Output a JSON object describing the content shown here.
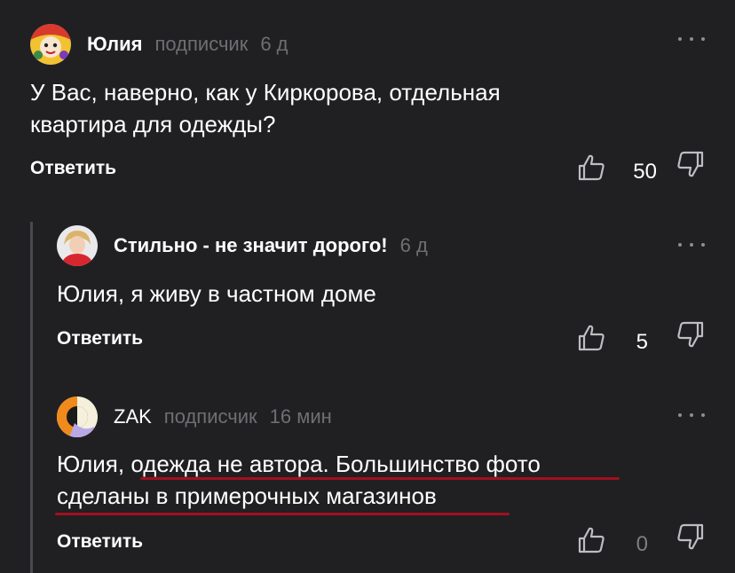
{
  "comments": [
    {
      "author": "Юлия",
      "role": "подписчик",
      "time": "6 д",
      "text_lines": [
        "У Вас, наверно, как у Киркорова, отдельная",
        "квартира для одежды?"
      ],
      "reply_label": "Ответить",
      "likes": "50",
      "avatar": "colorful-cartoon-avatar"
    },
    {
      "author": "Стильно - не значит дорого!",
      "role": "",
      "time": "6 д",
      "text_lines": [
        "Юлия, я живу в частном доме"
      ],
      "reply_label": "Ответить",
      "likes": "5",
      "avatar": "woman-photo-avatar"
    },
    {
      "author": "ZAK",
      "role": "подписчик",
      "time": "16 мин",
      "text_lines": [
        "Юлия, одежда не автора. Большинство фото",
        "сделаны в примерочных магазинов"
      ],
      "reply_label": "Ответить",
      "likes": "0",
      "avatar": "abstract-shapes-avatar"
    }
  ],
  "colors": {
    "background": "#202022",
    "muted_text": "#6f6f73",
    "thread_line": "#4a4a4e",
    "underline_annotation": "#a01020"
  },
  "icons": [
    "more-icon",
    "like-icon",
    "dislike-icon"
  ]
}
